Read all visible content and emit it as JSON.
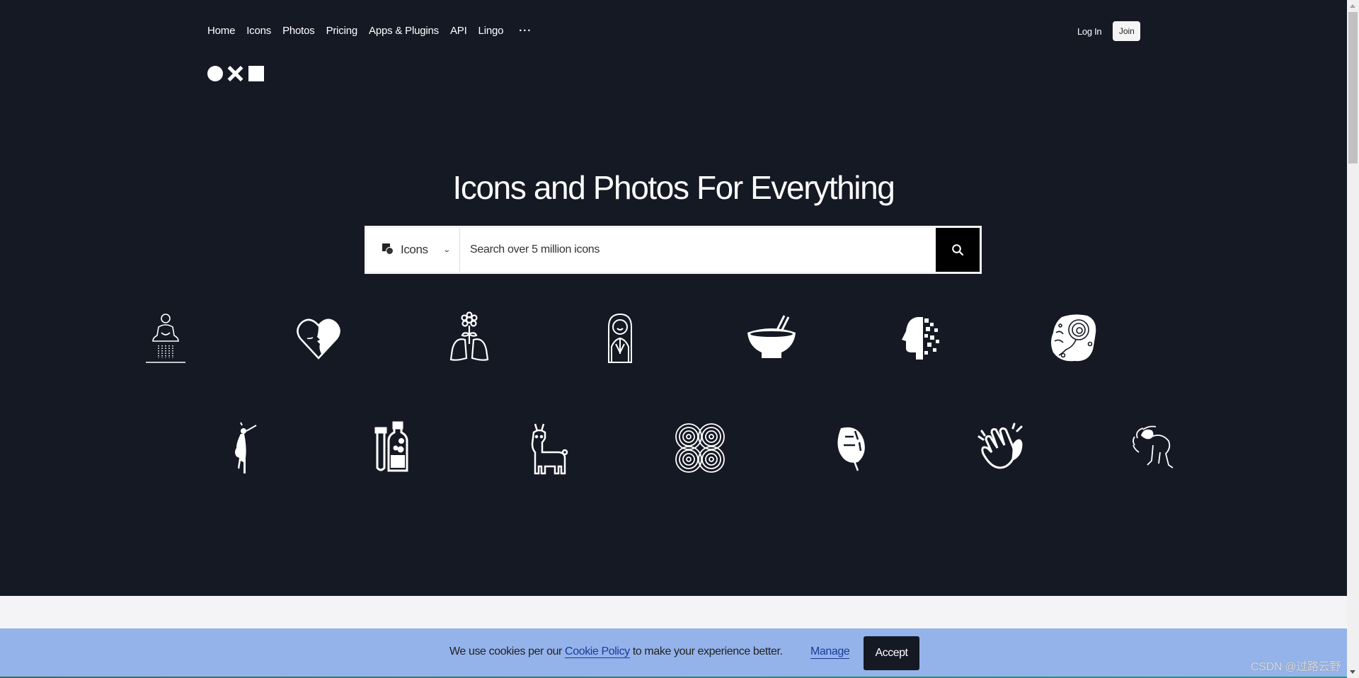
{
  "nav": {
    "items": [
      "Home",
      "Icons",
      "Photos",
      "Pricing",
      "Apps & Plugins",
      "API",
      "Lingo"
    ],
    "more_label": "···",
    "login_label": "Log In",
    "join_label": "Join"
  },
  "logo": {
    "shapes": [
      "circle",
      "x",
      "square"
    ]
  },
  "hero": {
    "title": "Icons and Photos For Everything",
    "search": {
      "type_label": "Icons",
      "type_icon": "shapes-icon",
      "placeholder": "Search over 5 million icons",
      "value": "",
      "button_icon": "search-icon"
    },
    "icon_rows": [
      [
        "meditating-buddha-icon",
        "heart-face-icon",
        "flower-lungs-icon",
        "woman-portrait-icon",
        "bowl-chopsticks-icon",
        "pixel-head-icon",
        "ammonite-fossil-icon"
      ],
      [
        "dancing-woman-icon",
        "test-tube-bottle-icon",
        "llama-icon",
        "concentric-loops-icon",
        "monstera-leaf-icon",
        "clapping-hands-icon",
        "dizzy-person-icon"
      ]
    ]
  },
  "cookie": {
    "text_before": "We use cookies per our ",
    "link": "Cookie Policy",
    "text_after": " to make your experience better.",
    "manage_label": "Manage",
    "accept_label": "Accept"
  },
  "watermark": "CSDN @过路云野",
  "colors": {
    "hero_bg": "#151924",
    "cookie_bg": "#94b3eb",
    "link": "#1b3a9a",
    "page_bg": "#f4f4f6"
  }
}
